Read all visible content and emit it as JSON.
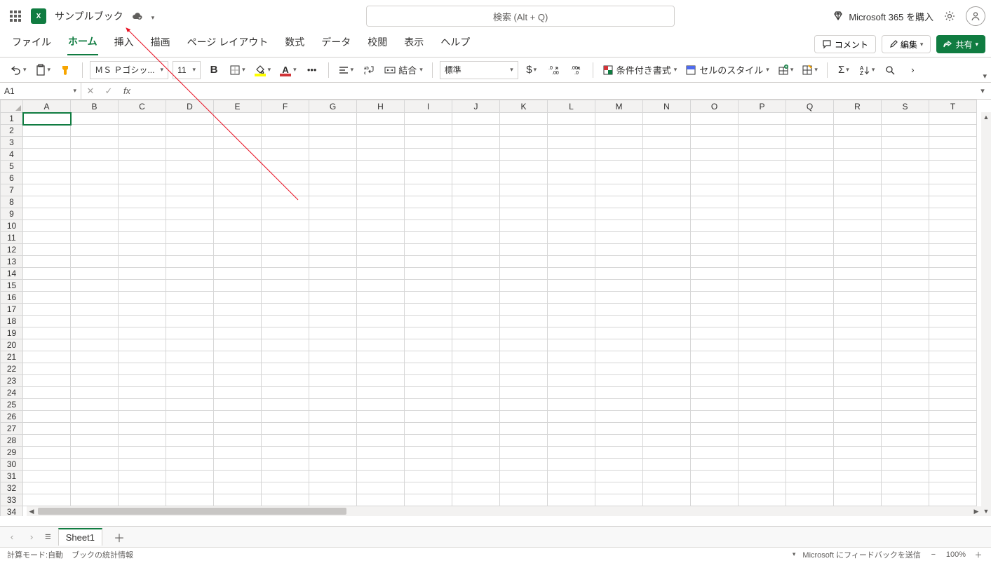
{
  "header": {
    "book_name": "サンプルブック",
    "search_placeholder": "検索 (Alt + Q)",
    "buy_label": "Microsoft 365 を購入",
    "excel_logo_text": "X"
  },
  "tabs": {
    "items": [
      "ファイル",
      "ホーム",
      "挿入",
      "描画",
      "ページ レイアウト",
      "数式",
      "データ",
      "校閲",
      "表示",
      "ヘルプ"
    ],
    "active_index": 1,
    "comment_label": "コメント",
    "edit_label": "編集",
    "share_label": "共有"
  },
  "ribbon": {
    "font_name": "ＭＳ Ｐゴシッ...",
    "font_size": "11",
    "merge_label": "結合",
    "number_format": "標準",
    "cond_fmt_label": "条件付き書式",
    "cell_style_label": "セルのスタイル"
  },
  "formula_bar": {
    "name_box": "A1",
    "formula_value": ""
  },
  "grid": {
    "columns": [
      "A",
      "B",
      "C",
      "D",
      "E",
      "F",
      "G",
      "H",
      "I",
      "J",
      "K",
      "L",
      "M",
      "N",
      "O",
      "P",
      "Q",
      "R",
      "S",
      "T"
    ],
    "row_count": 34,
    "selected_cell": "A1"
  },
  "sheet_tabs": {
    "active_sheet": "Sheet1"
  },
  "status": {
    "calc_mode_label": "計算モード:",
    "calc_mode_value": "自動",
    "book_stats_label": "ブックの統計情報",
    "feedback_label": "Microsoft にフィードバックを送信",
    "zoom_value": "100%"
  }
}
